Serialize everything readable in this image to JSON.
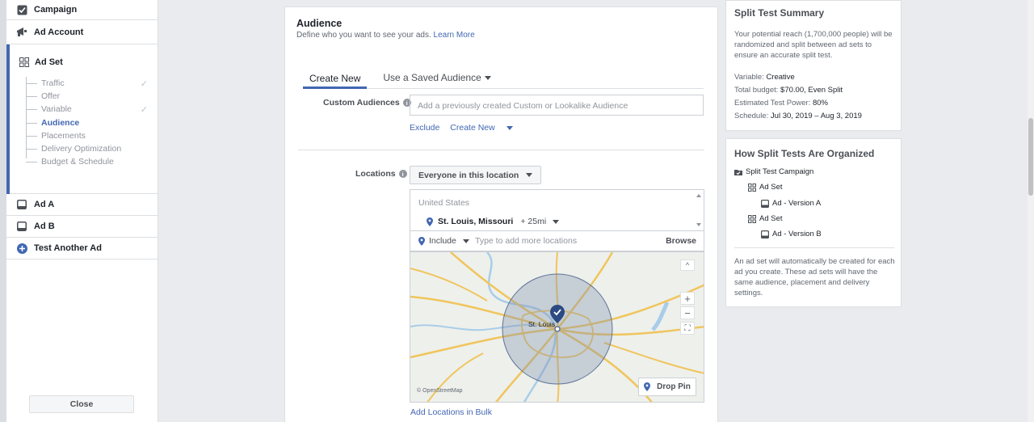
{
  "sidebar": {
    "campaign": "Campaign",
    "ad_account": "Ad Account",
    "ad_set": "Ad Set",
    "ad_set_steps": [
      "Traffic",
      "Offer",
      "Variable",
      "Audience",
      "Placements",
      "Delivery Optimization",
      "Budget & Schedule"
    ],
    "ad_a": "Ad A",
    "ad_b": "Ad B",
    "test_another": "Test Another Ad",
    "close": "Close"
  },
  "audience": {
    "title": "Audience",
    "subtitle": "Define who you want to see your ads.",
    "learn_more": "Learn More",
    "tab_create": "Create New",
    "tab_saved": "Use a Saved Audience",
    "custom_label": "Custom Audiences",
    "custom_placeholder": "Add a previously created Custom or Lookalike Audience",
    "exclude": "Exclude",
    "create_new": "Create New",
    "locations_label": "Locations",
    "location_scope": "Everyone in this location",
    "country": "United States",
    "city": "St. Louis, Missouri",
    "radius": "+ 25mi",
    "include": "Include",
    "location_placeholder": "Type to add more locations",
    "browse": "Browse",
    "map_city": "St. Louis",
    "map_credit": "© OpenStreetMap",
    "drop_pin": "Drop Pin",
    "add_bulk": "Add Locations in Bulk"
  },
  "summary": {
    "title": "Split Test Summary",
    "text": "Your potential reach (1,700,000 people) will be randomized and split between ad sets to ensure an accurate split test.",
    "variable_label": "Variable:",
    "variable_value": "Creative",
    "budget_label": "Total budget:",
    "budget_value": "$70.00, Even Split",
    "power_label": "Estimated Test Power:",
    "power_value": "80%",
    "schedule_label": "Schedule:",
    "schedule_value": "Jul 30, 2019 – Aug 3, 2019"
  },
  "organized": {
    "title": "How Split Tests Are Organized",
    "campaign": "Split Test Campaign",
    "ad_set": "Ad Set",
    "ad_version_a": "Ad - Version A",
    "ad_version_b": "Ad - Version B",
    "text": "An ad set will automatically be created for each ad you create. These ad sets will have the same audience, placement and delivery settings."
  },
  "colors": {
    "accent": "#4267b2",
    "map_road": "#f0c55c",
    "map_radius": "#7c8fb0"
  }
}
